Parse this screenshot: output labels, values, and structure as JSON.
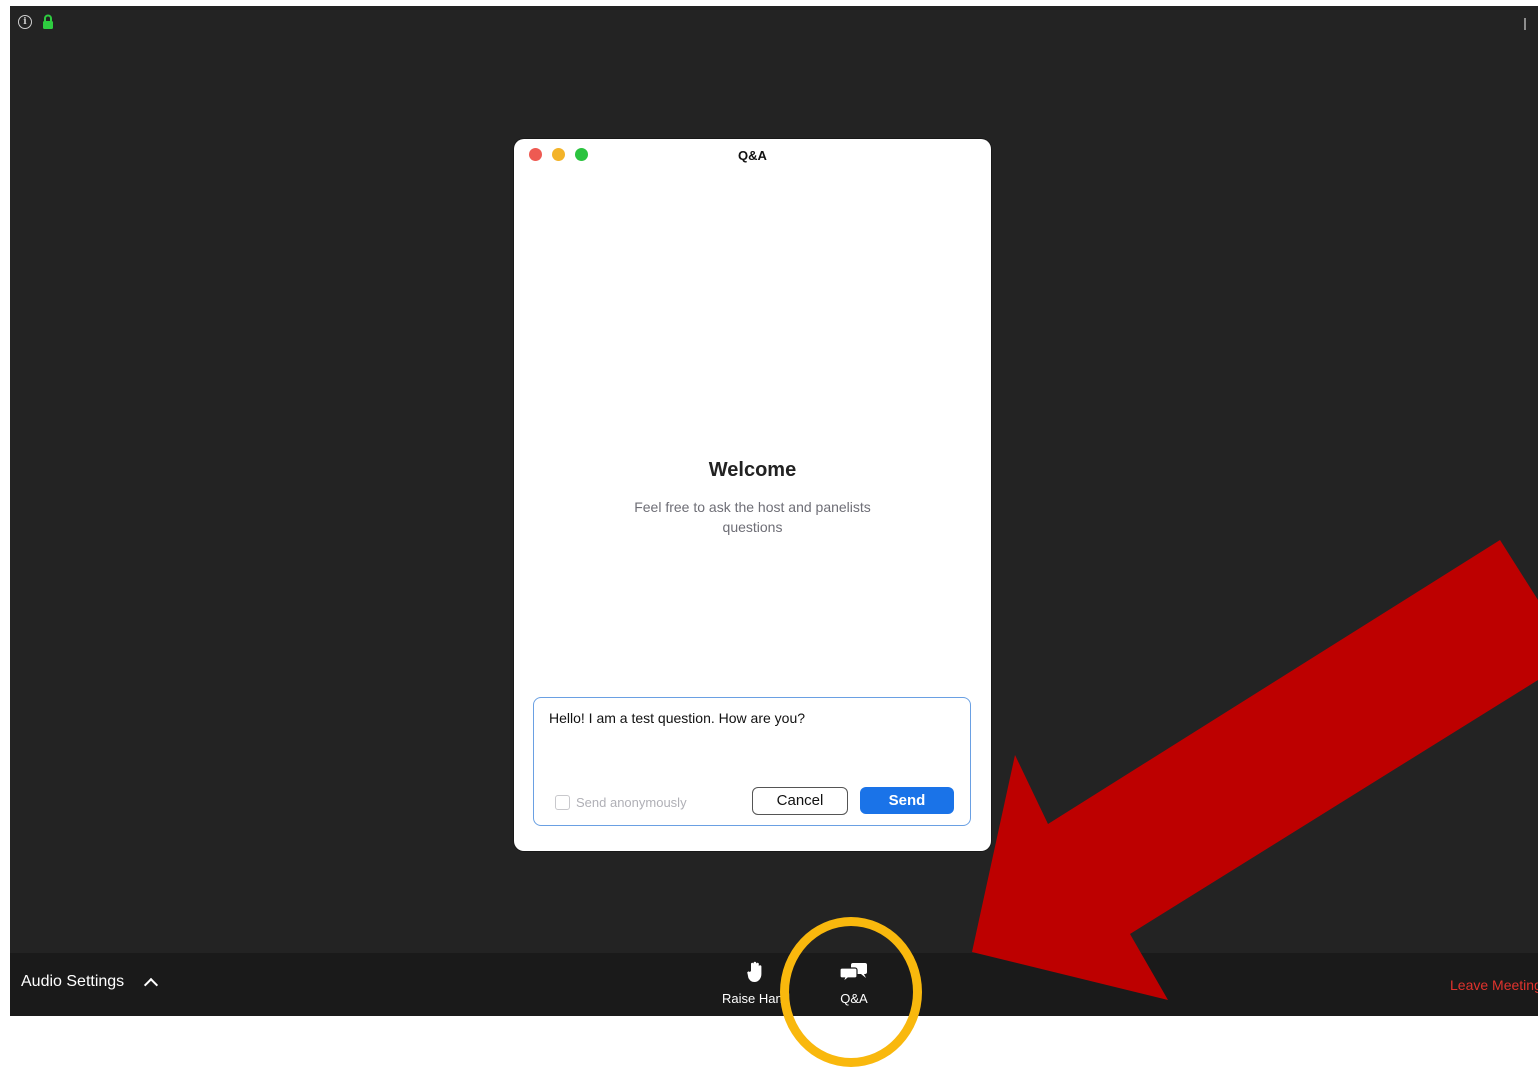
{
  "dialog": {
    "title": "Q&A",
    "welcome_title": "Welcome",
    "welcome_text": "Feel free to ask the host and panelists questions",
    "compose_text": "Hello! I am a test question. How are you?",
    "anonymous_label": "Send anonymously",
    "anonymous_checked": false,
    "cancel_label": "Cancel",
    "send_label": "Send"
  },
  "toolbar": {
    "audio_settings_label": "Audio Settings",
    "raise_hand_label": "Raise Hand",
    "qa_label": "Q&A",
    "leave_label": "Leave Meeting"
  },
  "icons": {
    "info": "info-icon",
    "lock": "lock-icon",
    "fullscreen": "fullscreen-icon",
    "chevron": "chevron-up-icon",
    "raise_hand": "hand-icon",
    "qa": "chat-bubbles-icon"
  },
  "colors": {
    "send_button": "#1a73e8",
    "leave": "#e0332d",
    "annotation_circle": "#f9b80d",
    "annotation_arrow": "#bd0000",
    "lock": "#2ecc40"
  }
}
